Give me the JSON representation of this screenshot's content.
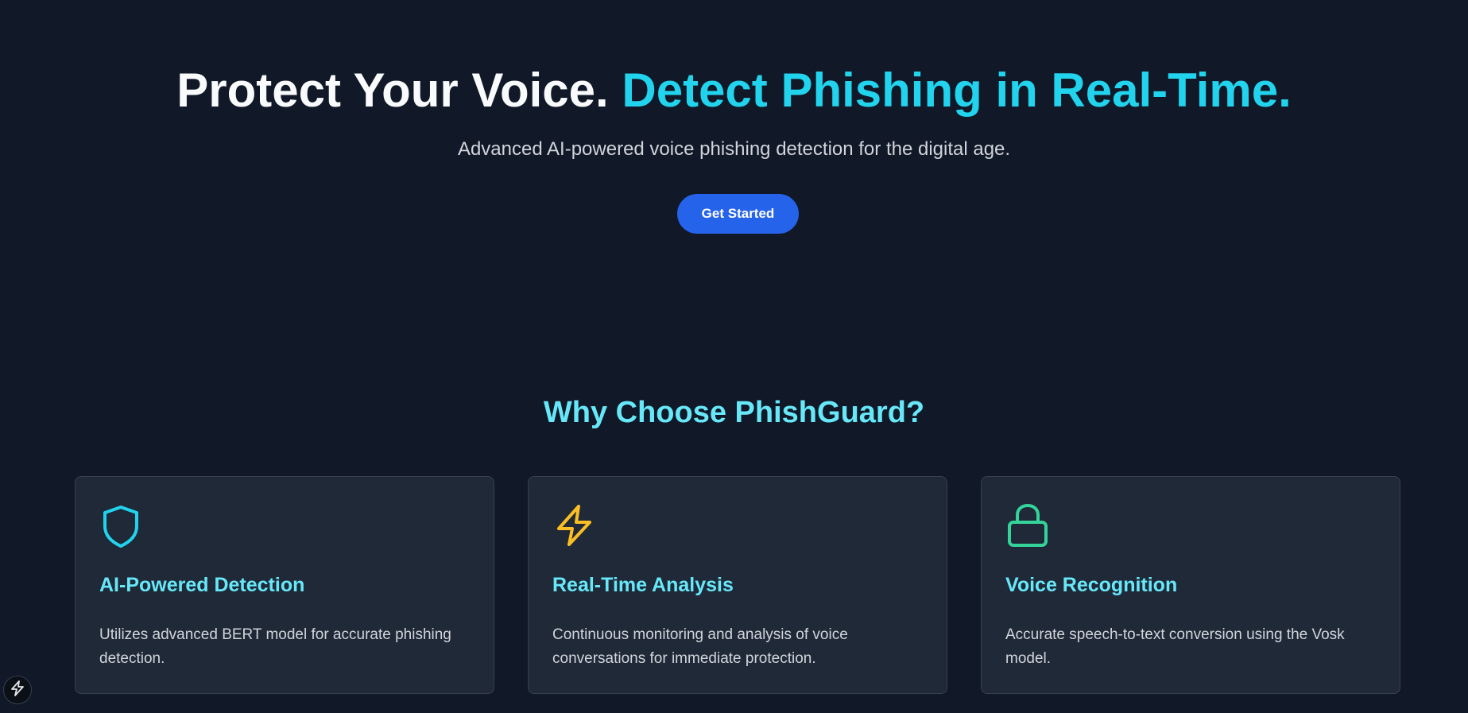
{
  "hero": {
    "title_part1": "Protect Your Voice.",
    "title_part2": "Detect Phishing in Real-Time.",
    "subtitle": "Advanced AI-powered voice phishing detection for the digital age.",
    "cta_label": "Get Started"
  },
  "features": {
    "heading": "Why Choose PhishGuard?",
    "items": [
      {
        "icon": "shield-icon",
        "icon_color": "#22d3ee",
        "title": "AI-Powered Detection",
        "description": "Utilizes advanced BERT model for accurate phishing detection."
      },
      {
        "icon": "lightning-icon",
        "icon_color": "#fbbf24",
        "title": "Real-Time Analysis",
        "description": "Continuous monitoring and analysis of voice conversations for immediate protection."
      },
      {
        "icon": "lock-icon",
        "icon_color": "#34d399",
        "title": "Voice Recognition",
        "description": "Accurate speech-to-text conversion using the Vosk model."
      }
    ]
  },
  "floating_button": {
    "icon": "lightning-icon"
  },
  "colors": {
    "background": "#111827",
    "accent_cyan": "#22d3ee",
    "heading_cyan": "#67e8f9",
    "cta_blue": "#2563eb",
    "card_background": "#1f2937"
  }
}
